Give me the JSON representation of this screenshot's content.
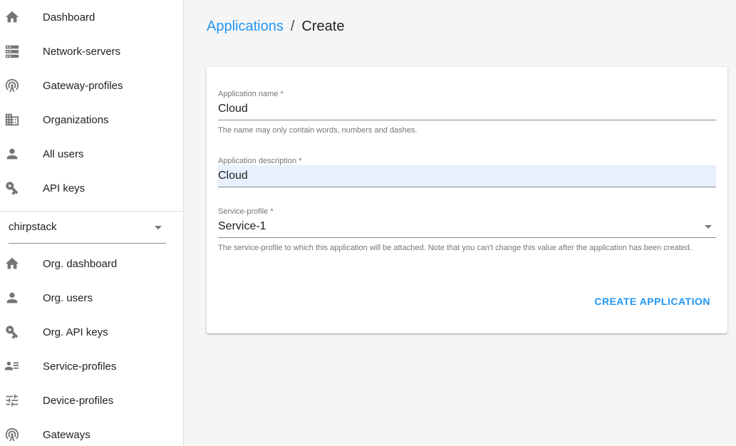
{
  "sidebar": {
    "top_items": [
      {
        "label": "Dashboard",
        "icon": "home-icon"
      },
      {
        "label": "Network-servers",
        "icon": "server-icon"
      },
      {
        "label": "Gateway-profiles",
        "icon": "radio-tower-icon"
      },
      {
        "label": "Organizations",
        "icon": "domain-icon"
      },
      {
        "label": "All users",
        "icon": "person-icon"
      },
      {
        "label": "API keys",
        "icon": "key-icon"
      }
    ],
    "org_select": {
      "value": "chirpstack"
    },
    "org_items": [
      {
        "label": "Org. dashboard",
        "icon": "home-icon"
      },
      {
        "label": "Org. users",
        "icon": "person-icon"
      },
      {
        "label": "Org. API keys",
        "icon": "key-icon"
      },
      {
        "label": "Service-profiles",
        "icon": "account-details-icon"
      },
      {
        "label": "Device-profiles",
        "icon": "tune-icon"
      },
      {
        "label": "Gateways",
        "icon": "radio-tower-icon"
      }
    ]
  },
  "breadcrumb": {
    "parent": "Applications",
    "separator": "/",
    "current": "Create"
  },
  "form": {
    "name": {
      "label": "Application name *",
      "value": "Cloud",
      "help": "The name may only contain words, numbers and dashes."
    },
    "description": {
      "label": "Application description *",
      "value": "Cloud"
    },
    "service_profile": {
      "label": "Service-profile *",
      "value": "Service-1",
      "help": "The service-profile to which this application will be attached. Note that you can't change this value after the application has been created."
    },
    "submit_label": "CREATE APPLICATION"
  },
  "colors": {
    "accent": "#2196f3",
    "autofill": "#e8f0fe",
    "icon": "#757575"
  }
}
